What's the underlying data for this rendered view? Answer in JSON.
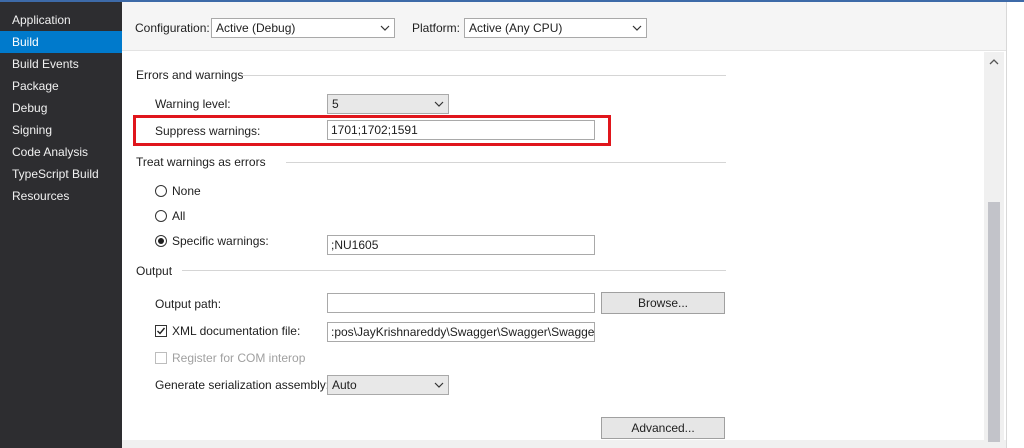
{
  "sidebar": {
    "items": [
      {
        "label": "Application"
      },
      {
        "label": "Build"
      },
      {
        "label": "Build Events"
      },
      {
        "label": "Package"
      },
      {
        "label": "Debug"
      },
      {
        "label": "Signing"
      },
      {
        "label": "Code Analysis"
      },
      {
        "label": "TypeScript Build"
      },
      {
        "label": "Resources"
      }
    ],
    "active": "Build"
  },
  "config": {
    "configuration_label": "Configuration:",
    "configuration_value": "Active (Debug)",
    "platform_label": "Platform:",
    "platform_value": "Active (Any CPU)"
  },
  "errors": {
    "section_title": "Errors and warnings",
    "warning_level_label": "Warning level:",
    "warning_level_value": "5",
    "suppress_label": "Suppress warnings:",
    "suppress_value": "1701;1702;1591"
  },
  "treat": {
    "section_title": "Treat warnings as errors",
    "none_label": "None",
    "all_label": "All",
    "specific_label": "Specific warnings:",
    "specific_value": ";NU1605",
    "selected": "specific"
  },
  "output": {
    "section_title": "Output",
    "path_label": "Output path:",
    "path_value": "",
    "browse_label": "Browse...",
    "xml_label": "XML documentation file:",
    "xml_checked": true,
    "xml_value": ":pos\\JayKrishnareddy\\Swagger\\Swagger\\Swagger.xml",
    "com_label": "Register for COM interop",
    "com_checked": false,
    "com_enabled": false,
    "serialization_label": "Generate serialization assembly:",
    "serialization_value": "Auto",
    "advanced_label": "Advanced..."
  },
  "colors": {
    "accent": "#007acc",
    "sidebar_bg": "#2d2d30",
    "highlight_box": "#e0161c"
  }
}
